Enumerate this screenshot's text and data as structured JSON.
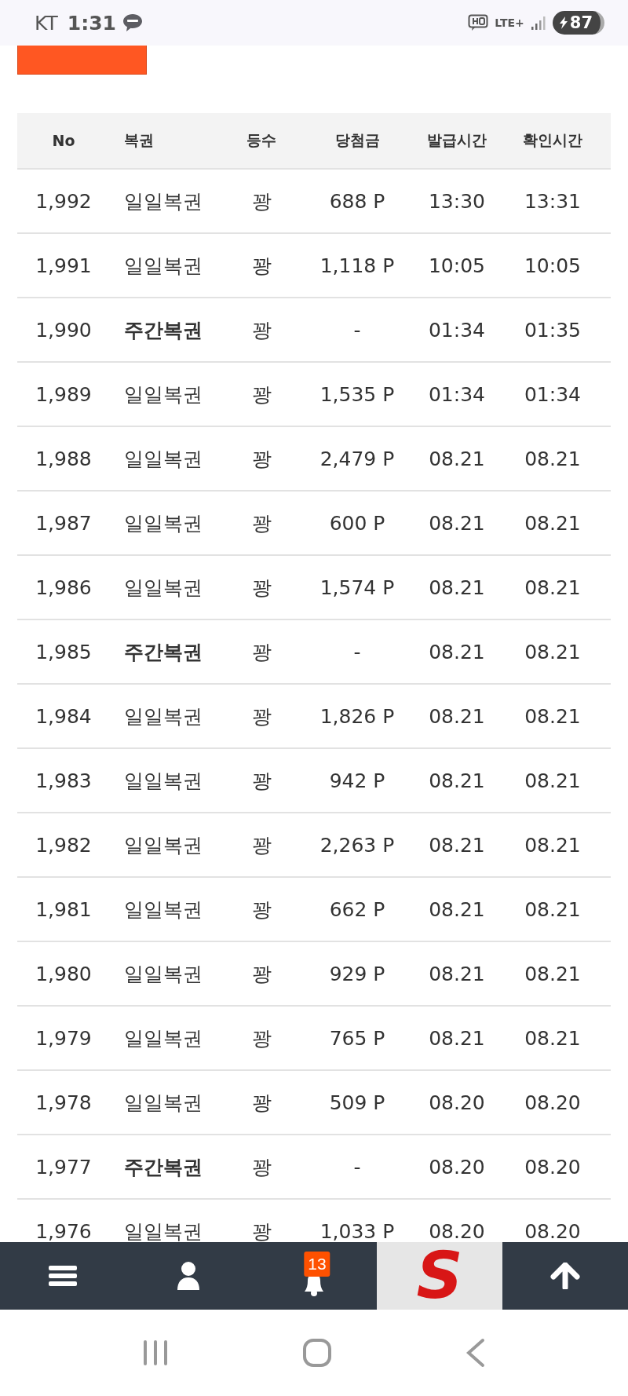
{
  "status_bar": {
    "carrier": "KT",
    "time": "1:31",
    "network": "LTE+",
    "battery": "87"
  },
  "table": {
    "columns": [
      "No",
      "복권",
      "등수",
      "당첨금",
      "발급시간",
      "확인시간"
    ],
    "rows": [
      {
        "no": "1,992",
        "kind": "daily",
        "lottery": "일일복권",
        "rank": "꽝",
        "prize": "688 P",
        "issued": "13:30",
        "checked": "13:31"
      },
      {
        "no": "1,991",
        "kind": "daily",
        "lottery": "일일복권",
        "rank": "꽝",
        "prize": "1,118 P",
        "issued": "10:05",
        "checked": "10:05"
      },
      {
        "no": "1,990",
        "kind": "weekly",
        "lottery": "주간복권",
        "rank": "꽝",
        "prize": "-",
        "issued": "01:34",
        "checked": "01:35"
      },
      {
        "no": "1,989",
        "kind": "daily",
        "lottery": "일일복권",
        "rank": "꽝",
        "prize": "1,535 P",
        "issued": "01:34",
        "checked": "01:34"
      },
      {
        "no": "1,988",
        "kind": "daily",
        "lottery": "일일복권",
        "rank": "꽝",
        "prize": "2,479 P",
        "issued": "08.21",
        "checked": "08.21"
      },
      {
        "no": "1,987",
        "kind": "daily",
        "lottery": "일일복권",
        "rank": "꽝",
        "prize": "600 P",
        "issued": "08.21",
        "checked": "08.21"
      },
      {
        "no": "1,986",
        "kind": "daily",
        "lottery": "일일복권",
        "rank": "꽝",
        "prize": "1,574 P",
        "issued": "08.21",
        "checked": "08.21"
      },
      {
        "no": "1,985",
        "kind": "weekly",
        "lottery": "주간복권",
        "rank": "꽝",
        "prize": "-",
        "issued": "08.21",
        "checked": "08.21"
      },
      {
        "no": "1,984",
        "kind": "daily",
        "lottery": "일일복권",
        "rank": "꽝",
        "prize": "1,826 P",
        "issued": "08.21",
        "checked": "08.21"
      },
      {
        "no": "1,983",
        "kind": "daily",
        "lottery": "일일복권",
        "rank": "꽝",
        "prize": "942 P",
        "issued": "08.21",
        "checked": "08.21"
      },
      {
        "no": "1,982",
        "kind": "daily",
        "lottery": "일일복권",
        "rank": "꽝",
        "prize": "2,263 P",
        "issued": "08.21",
        "checked": "08.21"
      },
      {
        "no": "1,981",
        "kind": "daily",
        "lottery": "일일복권",
        "rank": "꽝",
        "prize": "662 P",
        "issued": "08.21",
        "checked": "08.21"
      },
      {
        "no": "1,980",
        "kind": "daily",
        "lottery": "일일복권",
        "rank": "꽝",
        "prize": "929 P",
        "issued": "08.21",
        "checked": "08.21"
      },
      {
        "no": "1,979",
        "kind": "daily",
        "lottery": "일일복권",
        "rank": "꽝",
        "prize": "765 P",
        "issued": "08.21",
        "checked": "08.21"
      },
      {
        "no": "1,978",
        "kind": "daily",
        "lottery": "일일복권",
        "rank": "꽝",
        "prize": "509 P",
        "issued": "08.20",
        "checked": "08.20"
      },
      {
        "no": "1,977",
        "kind": "weekly",
        "lottery": "주간복권",
        "rank": "꽝",
        "prize": "-",
        "issued": "08.20",
        "checked": "08.20"
      },
      {
        "no": "1,976",
        "kind": "daily",
        "lottery": "일일복권",
        "rank": "꽝",
        "prize": "1,033 P",
        "issued": "08.20",
        "checked": "08.20"
      }
    ]
  },
  "bottom_nav": {
    "notification_count": "13",
    "logo": "S"
  }
}
